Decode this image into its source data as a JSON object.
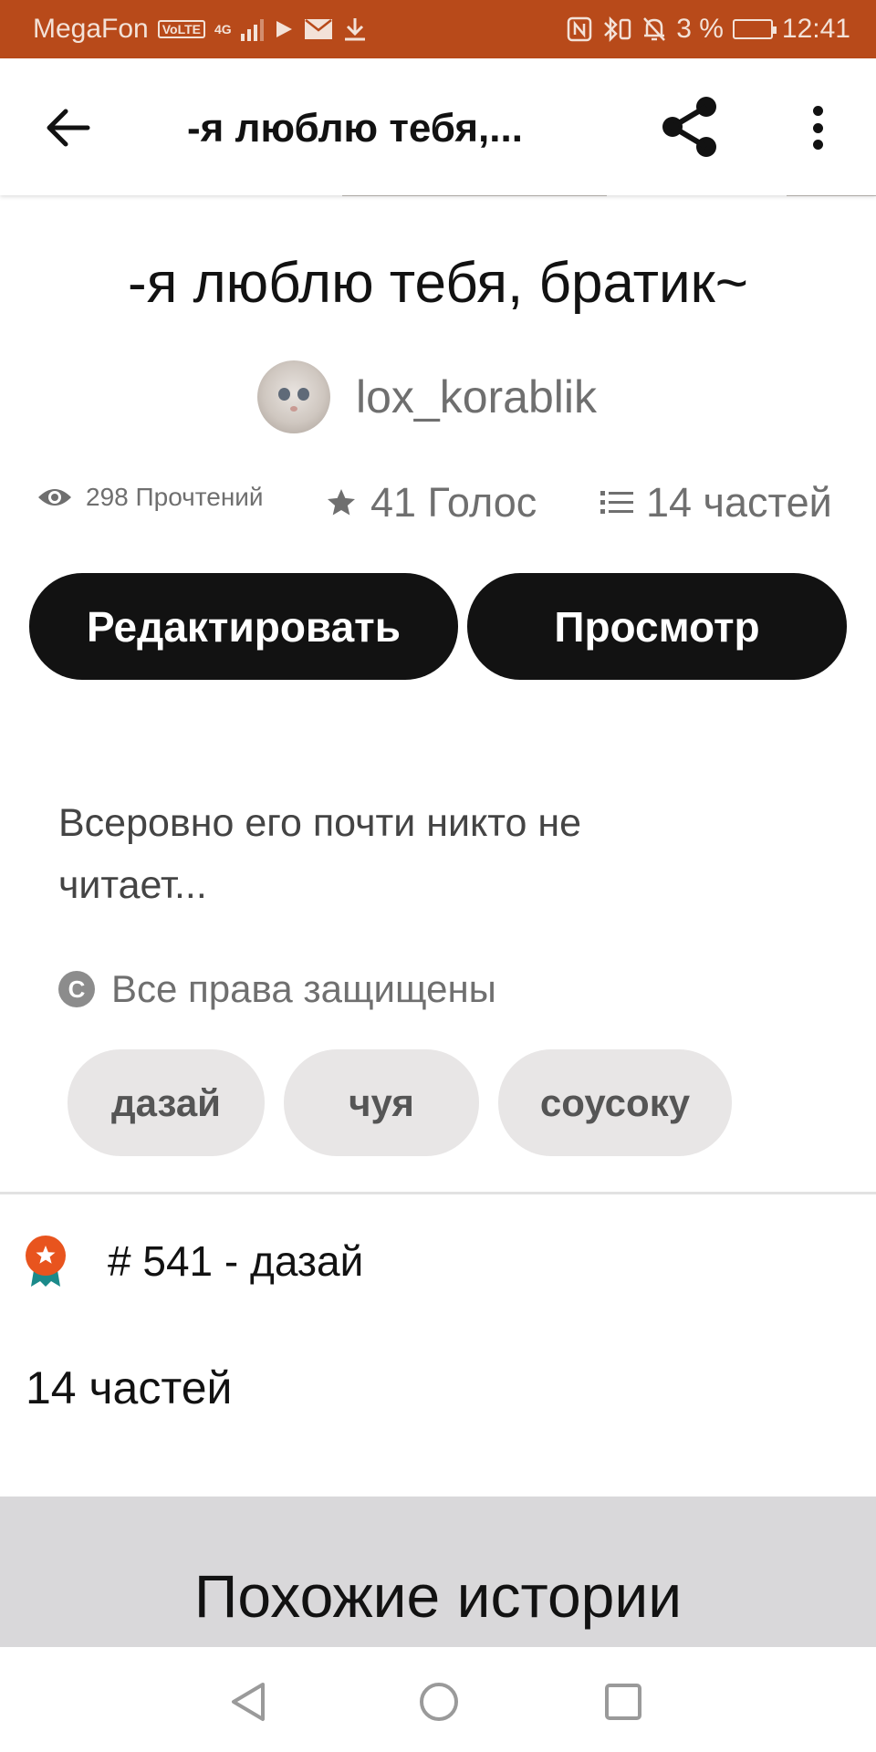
{
  "status_bar": {
    "carrier": "MegaFon",
    "volte": "VoLTE",
    "network": "4G",
    "battery": "3 %",
    "time": "12:41",
    "background_color": "#b84a1a"
  },
  "app_bar": {
    "title": "-я люблю тебя,...",
    "back_icon": "arrow-left-icon",
    "share_icon": "share-icon",
    "more_icon": "more-vertical-icon"
  },
  "story": {
    "title": "-я люблю тебя, братик~",
    "author": "lox_korablik",
    "reads": "298 Прочтений",
    "votes": "41 Голос",
    "parts": "14 частей",
    "edit_label": "Редактировать",
    "preview_label": "Просмотр",
    "description": "Всеровно его почти никто не читает...",
    "copyright": "Все права защищены",
    "tags": [
      "дазай",
      "чуя",
      "соусоку"
    ],
    "rank": "# 541 - дазай",
    "parts_count": "14 частей"
  },
  "similar": {
    "title": "Похожие истории",
    "background_color": "#d9d8da"
  },
  "nav": {
    "back_icon": "triangle-back-icon",
    "home_icon": "circle-home-icon",
    "recent_icon": "square-recent-icon"
  }
}
